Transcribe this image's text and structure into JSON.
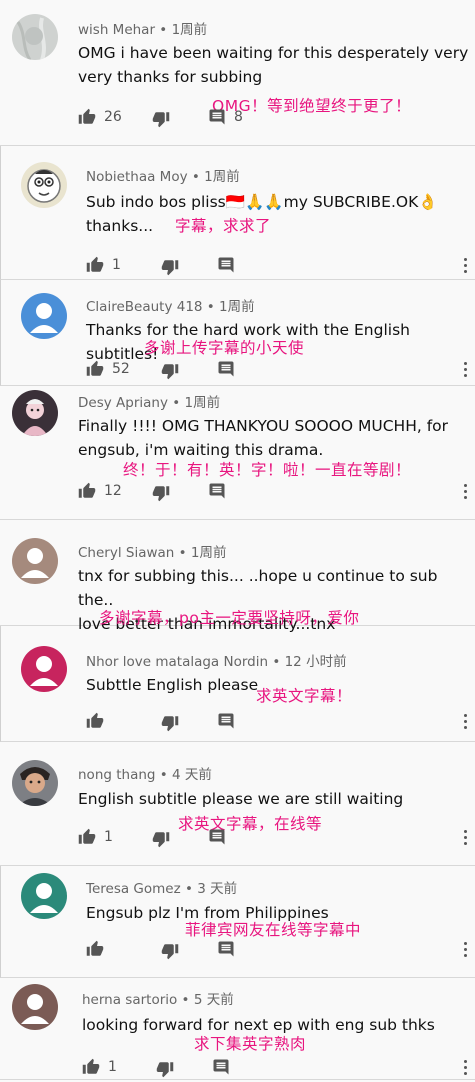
{
  "comments": [
    {
      "author": "wish Mehar",
      "time": "1周前",
      "text": "OMG i have been waiting for this desperately very\nvery thanks for subbing",
      "likes": "26",
      "replies": "8",
      "annotation": "OMG！等到绝望终于更了！",
      "avatar": "wallpaper-avatar"
    },
    {
      "author": "Nobiethaa Moy",
      "time": "1周前",
      "text": "Sub indo bos pliss🇮🇩🙏🙏my SUBCRIBE.OK👌\nthanks...",
      "likes": "1",
      "replies": "",
      "annotation": "字幕，求求了",
      "avatar": "cartoon-avatar"
    },
    {
      "author": "ClaireBeauty 418",
      "time": "1周前",
      "text": "Thanks for the hard work with the English subtitles!",
      "likes": "52",
      "replies": "",
      "annotation": "多谢上传字幕的小天使",
      "avatar": "default-avatar-blue"
    },
    {
      "author": "Desy Apriany",
      "time": "1周前",
      "text": "Finally !!!! OMG THANKYOU SOOOO MUCHH, for\nengsub, i'm waiting this drama.",
      "likes": "12",
      "replies": "",
      "annotation": "终！于！有！英！字！啦！一直在等剧！",
      "avatar": "photo-avatar-pink"
    },
    {
      "author": "Cheryl Siawan",
      "time": "1周前",
      "text": "tnx for subbing this... ..hope u continue to sub the..\nlove better than immortality...tnx",
      "likes": "",
      "replies": "",
      "annotation": "多谢字幕，po主一定要坚持呀，爱你",
      "avatar": "default-avatar-brown"
    },
    {
      "author": "Nhor love matalaga Nordin",
      "time": "12 小时前",
      "text": "Subttle English please",
      "likes": "",
      "replies": "",
      "annotation": "求英文字幕！",
      "avatar": "default-avatar-magenta"
    },
    {
      "author": "nong thang",
      "time": "4 天前",
      "text": "English subtitle please  we are still waiting",
      "likes": "1",
      "replies": "",
      "annotation": "求英文字幕，在线等",
      "avatar": "photo-avatar-person"
    },
    {
      "author": "Teresa Gomez",
      "time": "3 天前",
      "text": "Engsub plz I'm from Philippines",
      "likes": "",
      "replies": "",
      "annotation": "菲律宾网友在线等字幕中",
      "avatar": "default-avatar-teal"
    },
    {
      "author": "herna sartorio",
      "time": "5 天前",
      "text": "looking forward for next ep with eng sub thks",
      "likes": "1",
      "replies": "",
      "annotation": "求下集英字熟肉",
      "avatar": "default-avatar-darkbrown"
    }
  ],
  "separator": " • ",
  "icons": {
    "like": "thumb-up-icon",
    "dislike": "thumb-down-icon",
    "reply": "comment-icon",
    "menu": "more-vert-icon"
  },
  "colors": {
    "annotation": "#e8157f",
    "meta": "#666666",
    "icon": "#555555",
    "background": "#f9f9f9"
  }
}
